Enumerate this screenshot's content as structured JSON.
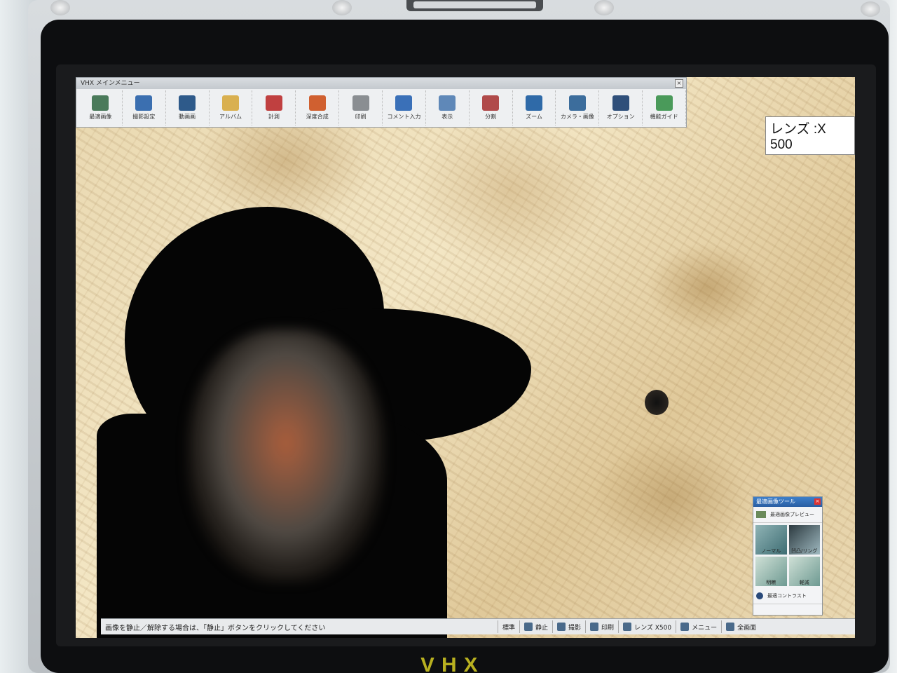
{
  "toolbar": {
    "title": "VHX メインメニュー",
    "close": "×",
    "buttons": [
      {
        "label": "最適画像",
        "icon": "image-icon",
        "color": "#4a7a5a"
      },
      {
        "label": "撮影設定",
        "icon": "camera-settings-icon",
        "color": "#3b6fb0"
      },
      {
        "label": "動画画",
        "icon": "video-icon",
        "color": "#2e5a8a"
      },
      {
        "label": "アルバム",
        "icon": "album-icon",
        "color": "#d9b050"
      },
      {
        "label": "計測",
        "icon": "measure-icon",
        "color": "#c04040"
      },
      {
        "label": "深度合成",
        "icon": "3d-icon",
        "color": "#d06030"
      },
      {
        "label": "印刷",
        "icon": "print-icon",
        "color": "#8a8e92"
      },
      {
        "label": "コメント入力",
        "icon": "comment-icon",
        "color": "#3a70b8"
      },
      {
        "label": "表示",
        "icon": "display-icon",
        "color": "#5f88b8"
      },
      {
        "label": "分割",
        "icon": "split-icon",
        "color": "#b04a4a"
      },
      {
        "label": "ズーム",
        "icon": "zoom-icon",
        "color": "#2f6aa8"
      },
      {
        "label": "カメラ・画像",
        "icon": "camera-image-icon",
        "color": "#3c6d9c"
      },
      {
        "label": "オプション",
        "icon": "tools-icon",
        "color": "#2f4f7a"
      },
      {
        "label": "機能ガイド",
        "icon": "guide-icon",
        "color": "#4a9a5a"
      }
    ]
  },
  "lens_label": "レンズ :X 500",
  "side_panel": {
    "title": "最適画像ツール",
    "close": "×",
    "preview_label": "最適画像プレビュー",
    "thumbs": [
      "ノーマル",
      "凹凸/リング",
      "明瞭",
      "軽減"
    ],
    "contrast_label": "最適コントラスト"
  },
  "statusbar": {
    "message": "画像を静止／解除する場合は、「静止」ボタンをクリックしてください",
    "items": [
      {
        "label": "標準",
        "icon": "",
        "name": "status-mode"
      },
      {
        "label": "静止",
        "icon": "freeze-icon",
        "name": "freeze-button"
      },
      {
        "label": "撮影",
        "icon": "camera-icon",
        "name": "capture-button"
      },
      {
        "label": "印刷",
        "icon": "print-icon",
        "name": "print-status-button"
      },
      {
        "label": "レンズ X500",
        "icon": "lens-icon",
        "name": "lens-button"
      },
      {
        "label": "メニュー",
        "icon": "menu-icon",
        "name": "menu-button"
      },
      {
        "label": "全画面",
        "icon": "fullscreen-icon",
        "name": "fullscreen-button"
      }
    ]
  },
  "device": {
    "logo": "VHX"
  }
}
